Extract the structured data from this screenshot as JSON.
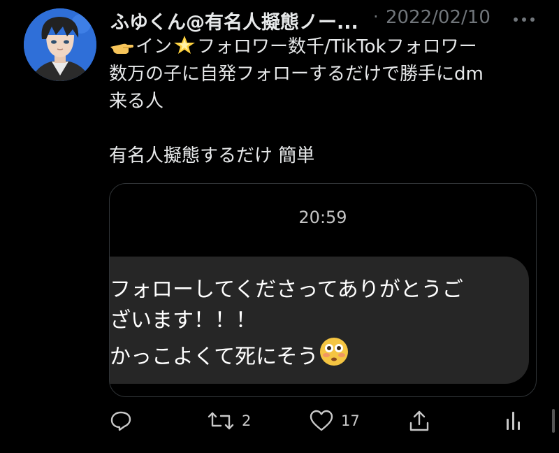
{
  "tweet": {
    "author": {
      "display_name": "ふゆくん@有名人擬態ノー...",
      "avatar_icon": "anime-boy-avatar"
    },
    "separator": "·",
    "date": "2022/02/10",
    "more_icon": "more-dots-icon",
    "text": {
      "line1_prefix": "イン",
      "line1_rest": "フォロワー数千/TikTokフォロワー",
      "line2": "数万の子に自発フォローするだけで勝手にdm",
      "line3": "来る人",
      "line5": "有名人擬態するだけ 簡単"
    },
    "media": {
      "time": "20:59",
      "message_lines": [
        "フォローしてくださってありがとうご",
        "ざいます！！！",
        "かっこよくて死にそう"
      ]
    },
    "actions": {
      "reply_icon": "reply-icon",
      "retweet_icon": "retweet-icon",
      "retweet_count": "2",
      "like_icon": "heart-icon",
      "like_count": "17",
      "share_icon": "share-icon",
      "analytics_icon": "analytics-icon"
    }
  },
  "colors": {
    "background": "#000000",
    "text": "#e7e9ea",
    "muted": "#71767b",
    "bubble": "#262626",
    "avatar_bg": "#2f6fd8"
  }
}
